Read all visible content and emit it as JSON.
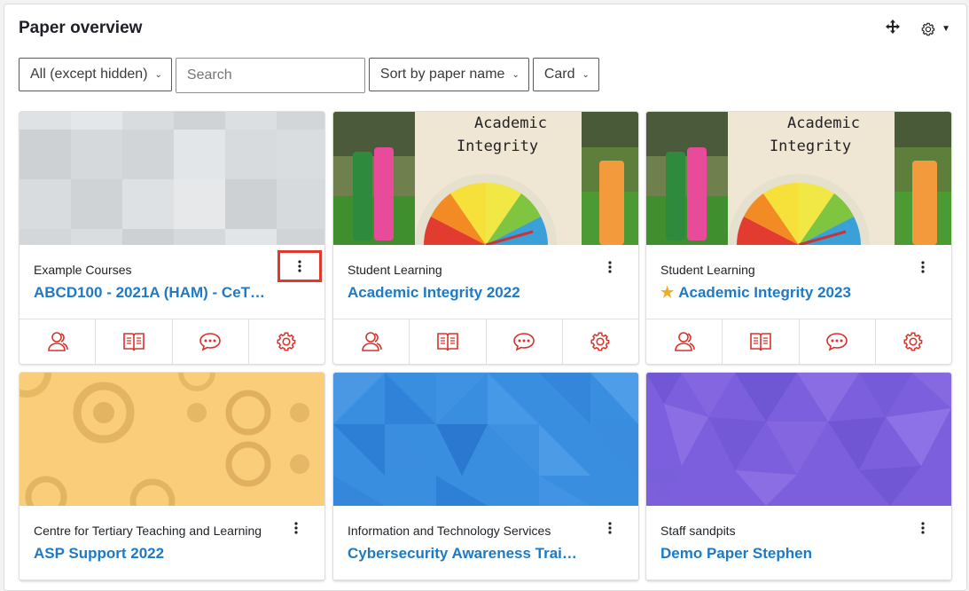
{
  "header": {
    "title": "Paper overview",
    "move_icon": "move-arrows-icon",
    "settings_icon": "gear-icon"
  },
  "filters": {
    "grouping": "All (except hidden)",
    "search_placeholder": "Search",
    "sort": "Sort by paper name",
    "view": "Card"
  },
  "cards": [
    {
      "category": "Example Courses",
      "name": "ABCD100 - 2021A (HAM) - CeT…",
      "starred": false,
      "image": "grey-pattern"
    },
    {
      "category": "Student Learning",
      "name": "Academic Integrity 2022",
      "starred": false,
      "image": "academic-integrity-drawing"
    },
    {
      "category": "Student Learning",
      "name": "Academic Integrity 2023",
      "starred": true,
      "image": "academic-integrity-drawing"
    },
    {
      "category": "Centre for Tertiary Teaching and Learning",
      "name": "ASP Support 2022",
      "starred": false,
      "image": "yellow-circles-pattern"
    },
    {
      "category": "Information and Technology Services",
      "name": "Cybersecurity Awareness Trai…",
      "starred": false,
      "image": "blue-triangles-pattern"
    },
    {
      "category": "Staff sandpits",
      "name": "Demo Paper Stephen",
      "starred": false,
      "image": "purple-hexagon-pattern"
    }
  ],
  "card_actions": [
    "participants-icon",
    "grades-book-icon",
    "forum-chat-icon",
    "settings-gear-icon"
  ],
  "colors": {
    "accent": "#1e7ac4",
    "action_icon": "#d6332a",
    "highlight": "#e03a2f",
    "star": "#f0ad1e"
  }
}
